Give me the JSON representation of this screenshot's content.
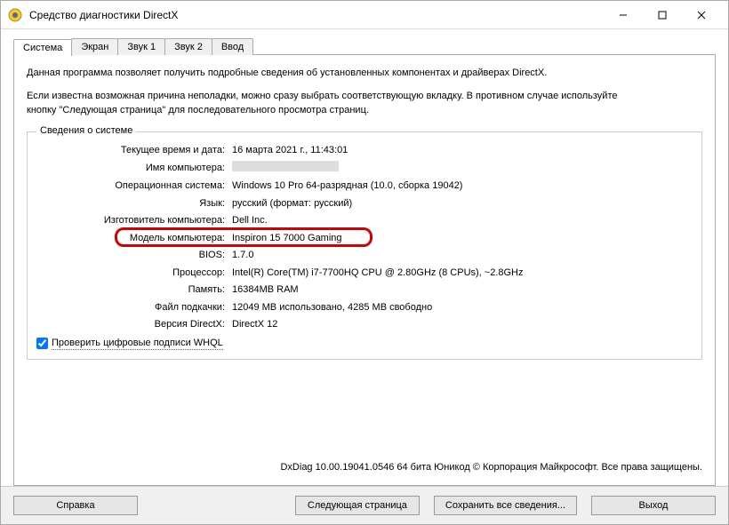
{
  "window": {
    "title": "Средство диагностики DirectX"
  },
  "tabs": {
    "system": "Система",
    "screen": "Экран",
    "sound1": "Звук 1",
    "sound2": "Звук 2",
    "input": "Ввод"
  },
  "intro": {
    "line1": "Данная программа позволяет получить подробные сведения об установленных компонентах и драйверах DirectX.",
    "line2": "Если известна возможная причина неполадки, можно сразу выбрать соответствующую вкладку. В противном случае используйте",
    "line3": "кнопку \"Следующая страница\" для последовательного просмотра страниц."
  },
  "group": {
    "title": "Сведения о системе",
    "rows": {
      "datetime_label": "Текущее время и дата:",
      "datetime_value": "16 марта 2021 г., 11:43:01",
      "computer_name_label": "Имя компьютера:",
      "os_label": "Операционная система:",
      "os_value": "Windows 10 Pro 64-разрядная (10.0, сборка 19042)",
      "lang_label": "Язык:",
      "lang_value": "русский (формат: русский)",
      "manufacturer_label": "Изготовитель компьютера:",
      "manufacturer_value": "Dell Inc.",
      "model_label": "Модель компьютера:",
      "model_value": "Inspiron 15 7000 Gaming",
      "bios_label": "BIOS:",
      "bios_value": "1.7.0",
      "cpu_label": "Процессор:",
      "cpu_value": "Intel(R) Core(TM) i7-7700HQ CPU @ 2.80GHz (8 CPUs), ~2.8GHz",
      "ram_label": "Память:",
      "ram_value": "16384MB RAM",
      "pagefile_label": "Файл подкачки:",
      "pagefile_value": "12049 MB использовано, 4285 MB свободно",
      "directx_label": "Версия DirectX:",
      "directx_value": "DirectX 12"
    },
    "checkbox_label": "Проверить цифровые подписи WHQL"
  },
  "footer": "DxDiag 10.00.19041.0546 64 бита Юникод © Корпорация Майкрософт. Все права защищены.",
  "buttons": {
    "help": "Справка",
    "next": "Следующая страница",
    "save": "Сохранить все сведения...",
    "exit": "Выход"
  }
}
